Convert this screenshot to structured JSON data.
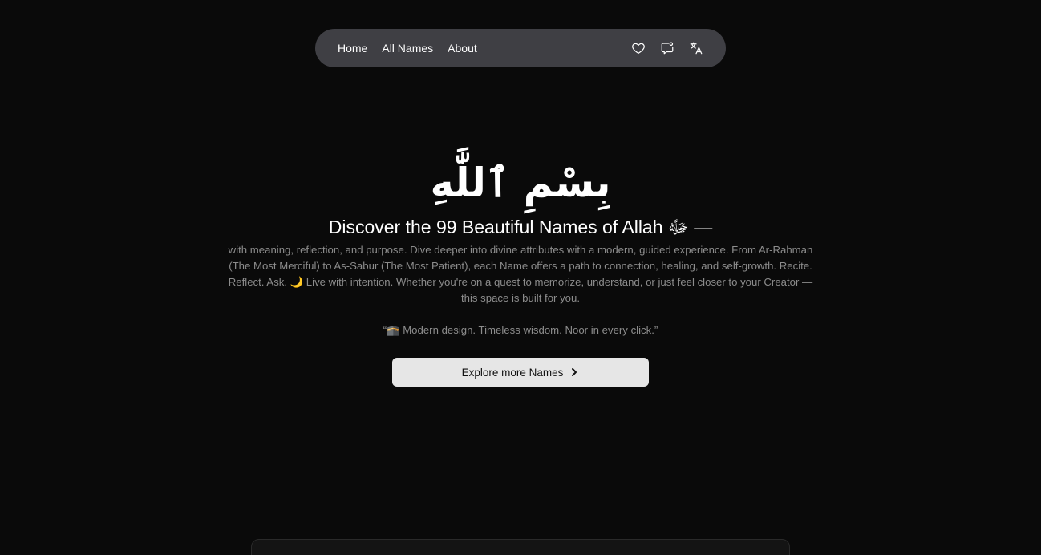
{
  "nav": {
    "links": [
      "Home",
      "All Names",
      "About"
    ],
    "icons": [
      "heart-icon",
      "feedback-icon",
      "translate-icon"
    ]
  },
  "hero": {
    "bismillah": "بِسْمِ ٱللَّٰهِ",
    "title": "Discover the 99 Beautiful Names of Allah ﷻ —",
    "description": "with meaning, reflection, and purpose. Dive deeper into divine attributes with a modern, guided experience. From Ar-Rahman (The Most Merciful) to As-Sabur (The Most Patient), each Name offers a path to connection, healing, and self-growth. Recite. Reflect. Ask. 🌙 Live with intention. Whether you're on a quest to memorize, understand, or just feel closer to your Creator — this space is built for you.",
    "quote": "“🕋 Modern design. Timeless wisdom. Noor in every click.”"
  },
  "cta": {
    "label": "Explore more Names"
  },
  "colors": {
    "background": "#0a0a0a",
    "navbar": "#3f3f44",
    "muted_text": "#8c8c8c",
    "button_bg": "#e6e6e6"
  }
}
